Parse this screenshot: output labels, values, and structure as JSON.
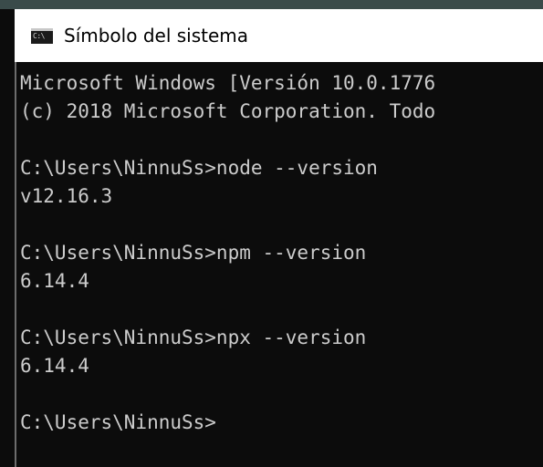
{
  "window": {
    "title": "Símbolo del sistema",
    "icon_label": "C:\\"
  },
  "console": {
    "lines": [
      "Microsoft Windows [Versión 10.0.1776",
      "(c) 2018 Microsoft Corporation. Todo",
      "",
      "C:\\Users\\NinnuSs>node --version",
      "v12.16.3",
      "",
      "C:\\Users\\NinnuSs>npm --version",
      "6.14.4",
      "",
      "C:\\Users\\NinnuSs>npx --version",
      "6.14.4",
      "",
      "C:\\Users\\NinnuSs>"
    ]
  },
  "colors": {
    "console_bg": "#0c0c0c",
    "console_text": "#cccccc",
    "titlebar_bg": "#ffffff"
  }
}
